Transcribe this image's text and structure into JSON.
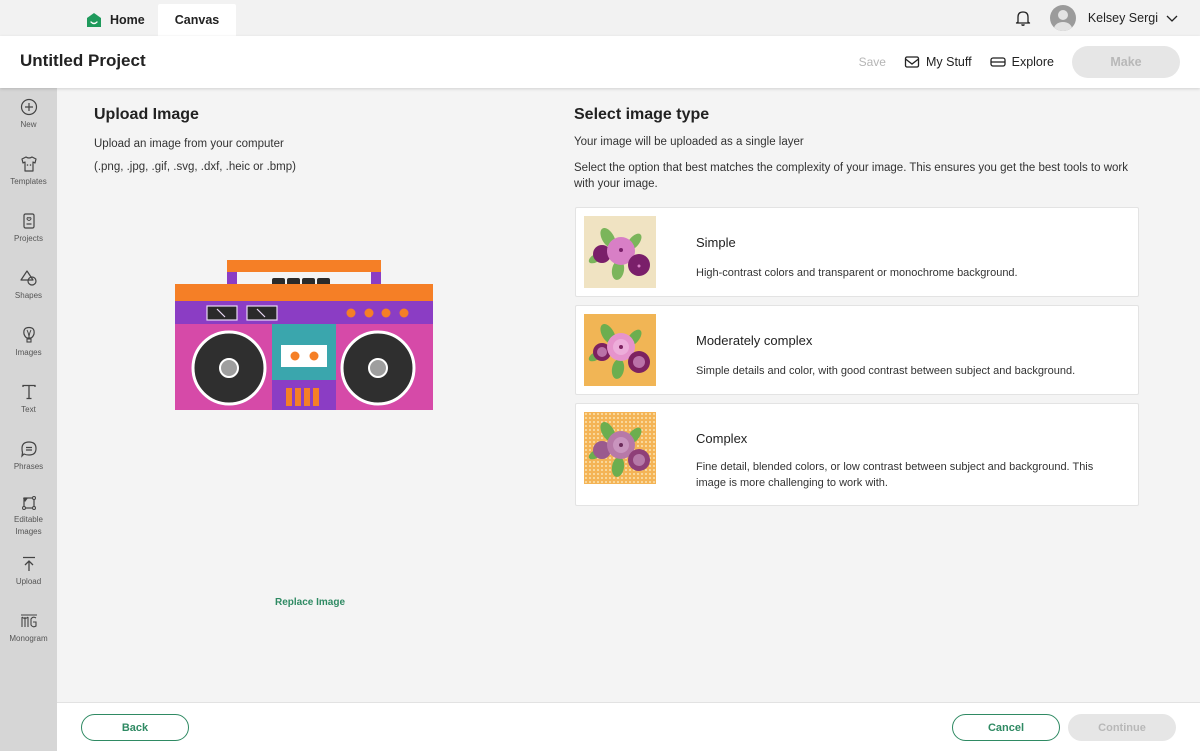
{
  "tabs": {
    "home_label": "Home",
    "canvas_label": "Canvas"
  },
  "user": {
    "name": "Kelsey Sergi"
  },
  "header": {
    "project_title": "Untitled Project",
    "save_label": "Save",
    "my_stuff_label": "My Stuff",
    "explore_label": "Explore",
    "make_label": "Make"
  },
  "sidebar": {
    "items": [
      {
        "label": "New",
        "icon": "plus-circle-icon"
      },
      {
        "label": "Templates",
        "icon": "tshirt-icon"
      },
      {
        "label": "Projects",
        "icon": "projects-icon"
      },
      {
        "label": "Shapes",
        "icon": "shapes-icon"
      },
      {
        "label": "Images",
        "icon": "lightbulb-icon"
      },
      {
        "label": "Text",
        "icon": "text-icon"
      },
      {
        "label": "Phrases",
        "icon": "speech-bubble-icon"
      },
      {
        "label": "Editable Images",
        "icon": "editable-images-icon"
      },
      {
        "label": "Upload",
        "icon": "upload-icon"
      },
      {
        "label": "Monogram",
        "icon": "monogram-icon"
      }
    ]
  },
  "upload": {
    "title": "Upload Image",
    "description": "Upload an image from your computer",
    "formats": "(.png, .jpg, .gif, .svg, .dxf, .heic or .bmp)",
    "replace_label": "Replace Image"
  },
  "select": {
    "title": "Select image type",
    "subtitle": "Your image will be uploaded as a single layer",
    "description": "Select the option that best matches the complexity of your image. This ensures you get the best tools to work with your image.",
    "options": [
      {
        "name": "Simple",
        "text": "High-contrast colors and transparent or monochrome background."
      },
      {
        "name": "Moderately complex",
        "text": "Simple details and color, with good contrast between subject and background."
      },
      {
        "name": "Complex",
        "text": "Fine detail, blended colors, or low contrast between subject and background. This image is more challenging to work with."
      }
    ]
  },
  "footer": {
    "back_label": "Back",
    "cancel_label": "Cancel",
    "continue_label": "Continue"
  },
  "colors": {
    "accent": "#2f8a63",
    "disabled_bg": "#e6e6e6",
    "disabled_text": "#b8b8b8"
  }
}
